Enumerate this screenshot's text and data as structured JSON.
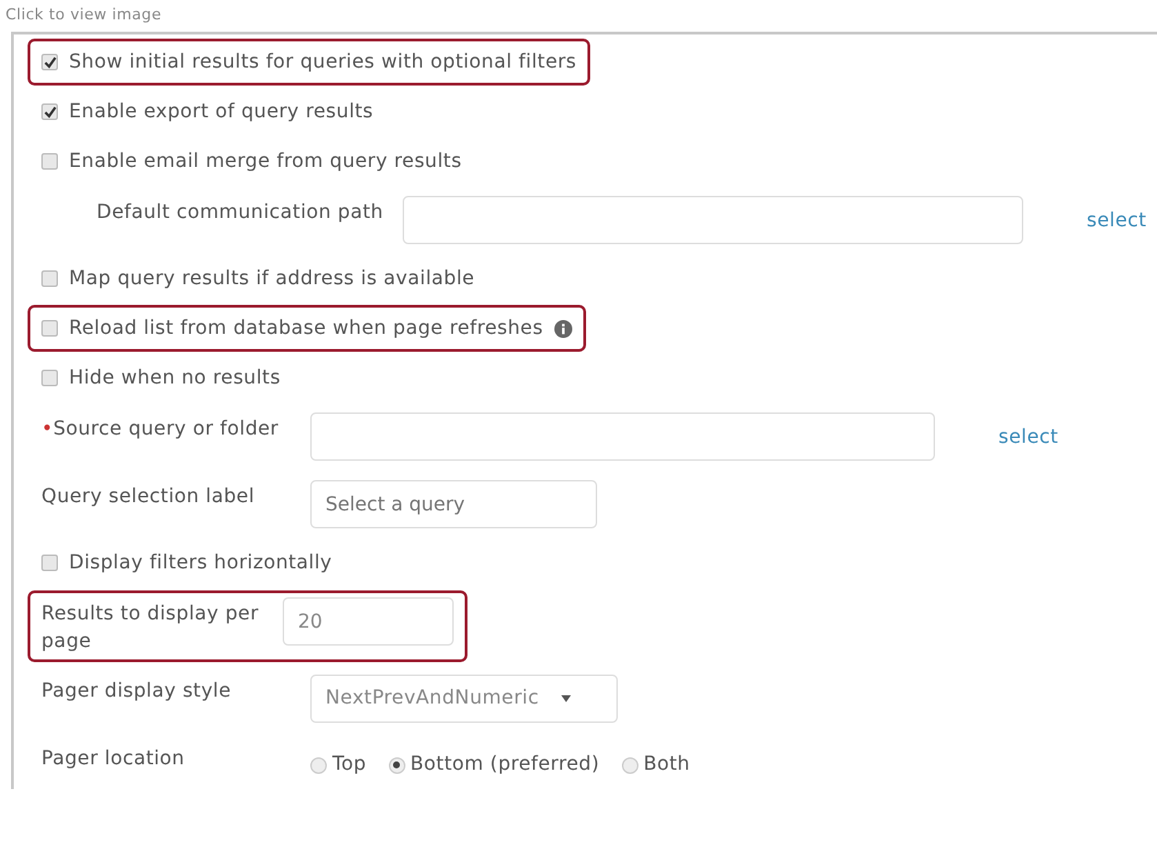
{
  "caption": "Click to view image",
  "rows": [
    {
      "kind": "checkbox",
      "label": "Show initial results for queries with optional filters",
      "checked": true,
      "highlighted": true
    },
    {
      "kind": "checkbox",
      "label": "Enable export of query results",
      "checked": true
    },
    {
      "kind": "checkbox",
      "label": "Enable email merge from query results",
      "checked": false
    },
    {
      "kind": "field",
      "label": "Default communication path",
      "indented": true,
      "link": "select"
    },
    {
      "kind": "checkbox",
      "label": "Map query results if address is available",
      "checked": false
    },
    {
      "kind": "checkbox",
      "label": "Reload list from database when page refreshes",
      "checked": false,
      "info": true,
      "highlighted": true
    },
    {
      "kind": "checkbox",
      "label": "Hide when no results",
      "checked": false
    },
    {
      "kind": "field",
      "label": "Source query or folder",
      "required_mark": "•",
      "link": "select"
    },
    {
      "kind": "field",
      "label": "Query selection label",
      "placeholder": "Select a query"
    },
    {
      "kind": "checkbox",
      "label": "Display filters horizontally",
      "checked": false
    },
    {
      "kind": "field",
      "label": "Results to display per page",
      "value": "20",
      "highlighted": true
    },
    {
      "kind": "select",
      "label": "Pager display style",
      "value": "NextPrevAndNumeric"
    },
    {
      "kind": "radios",
      "label": "Pager location",
      "options": [
        {
          "label": "Top",
          "selected": false
        },
        {
          "label": "Bottom (preferred)",
          "selected": true
        },
        {
          "label": "Both",
          "selected": false
        }
      ]
    }
  ]
}
